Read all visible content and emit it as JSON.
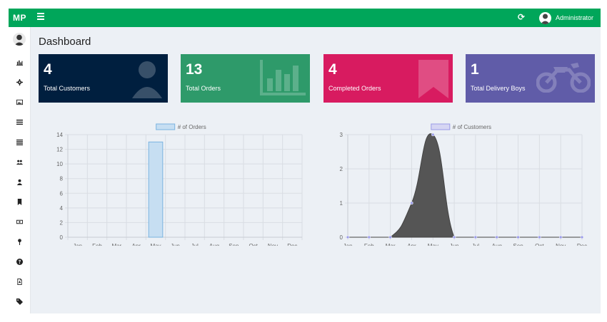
{
  "topbar": {
    "brand": "MP",
    "user_name": "Administrator"
  },
  "page": {
    "title": "Dashboard"
  },
  "sidebar": {
    "items": [
      {
        "icon": "bar-chart-icon"
      },
      {
        "icon": "gear-icon"
      },
      {
        "icon": "image-icon"
      },
      {
        "icon": "list-icon"
      },
      {
        "icon": "list-icon"
      },
      {
        "icon": "users-icon"
      },
      {
        "icon": "user-icon"
      },
      {
        "icon": "bookmark-icon"
      },
      {
        "icon": "money-icon"
      },
      {
        "icon": "map-pin-icon"
      },
      {
        "icon": "question-icon"
      },
      {
        "icon": "file-pdf-icon"
      },
      {
        "icon": "tag-icon"
      }
    ]
  },
  "stats": [
    {
      "value": "4",
      "label": "Total Customers",
      "color": "#001f3f",
      "icon": "user-icon"
    },
    {
      "value": "13",
      "label": "Total Orders",
      "color": "#2e9a6a",
      "icon": "bar-chart-icon"
    },
    {
      "value": "4",
      "label": "Completed Orders",
      "color": "#d81b60",
      "icon": "bookmark-icon"
    },
    {
      "value": "1",
      "label": "Total Delivery Boys",
      "color": "#605ca8",
      "icon": "motorcycle-icon"
    }
  ],
  "chart_data": [
    {
      "type": "bar",
      "categories": [
        "Jan",
        "Feb",
        "Mar",
        "Apr",
        "May",
        "Jun",
        "Jul",
        "Aug",
        "Sep",
        "Oct",
        "Nov",
        "Dec"
      ],
      "series": [
        {
          "name": "# of Orders",
          "values": [
            0,
            0,
            0,
            0,
            13,
            0,
            0,
            0,
            0,
            0,
            0,
            0
          ]
        }
      ],
      "yticks": [
        "0",
        "2",
        "4",
        "6",
        "8",
        "10",
        "12",
        "14"
      ],
      "ylim": [
        0,
        14
      ],
      "grid": true,
      "legend": "top",
      "colors": {
        "fill": "#c6def2",
        "stroke": "#7ab3e0"
      }
    },
    {
      "type": "area",
      "categories": [
        "Jan",
        "Feb",
        "Mar",
        "Apr",
        "May",
        "Jun",
        "Jul",
        "Aug",
        "Sep",
        "Oct",
        "Nov",
        "Dec"
      ],
      "series": [
        {
          "name": "# of Customers",
          "values": [
            0,
            0,
            0,
            1,
            3,
            0,
            0,
            0,
            0,
            0,
            0,
            0
          ]
        }
      ],
      "yticks": [
        "0",
        "1",
        "2",
        "3"
      ],
      "ylim": [
        0,
        3
      ],
      "grid": true,
      "legend": "top",
      "colors": {
        "fill": "#555555",
        "point": "#9a9be8",
        "legend_fill": "#d6d6f3",
        "legend_stroke": "#9a9be8"
      }
    }
  ]
}
